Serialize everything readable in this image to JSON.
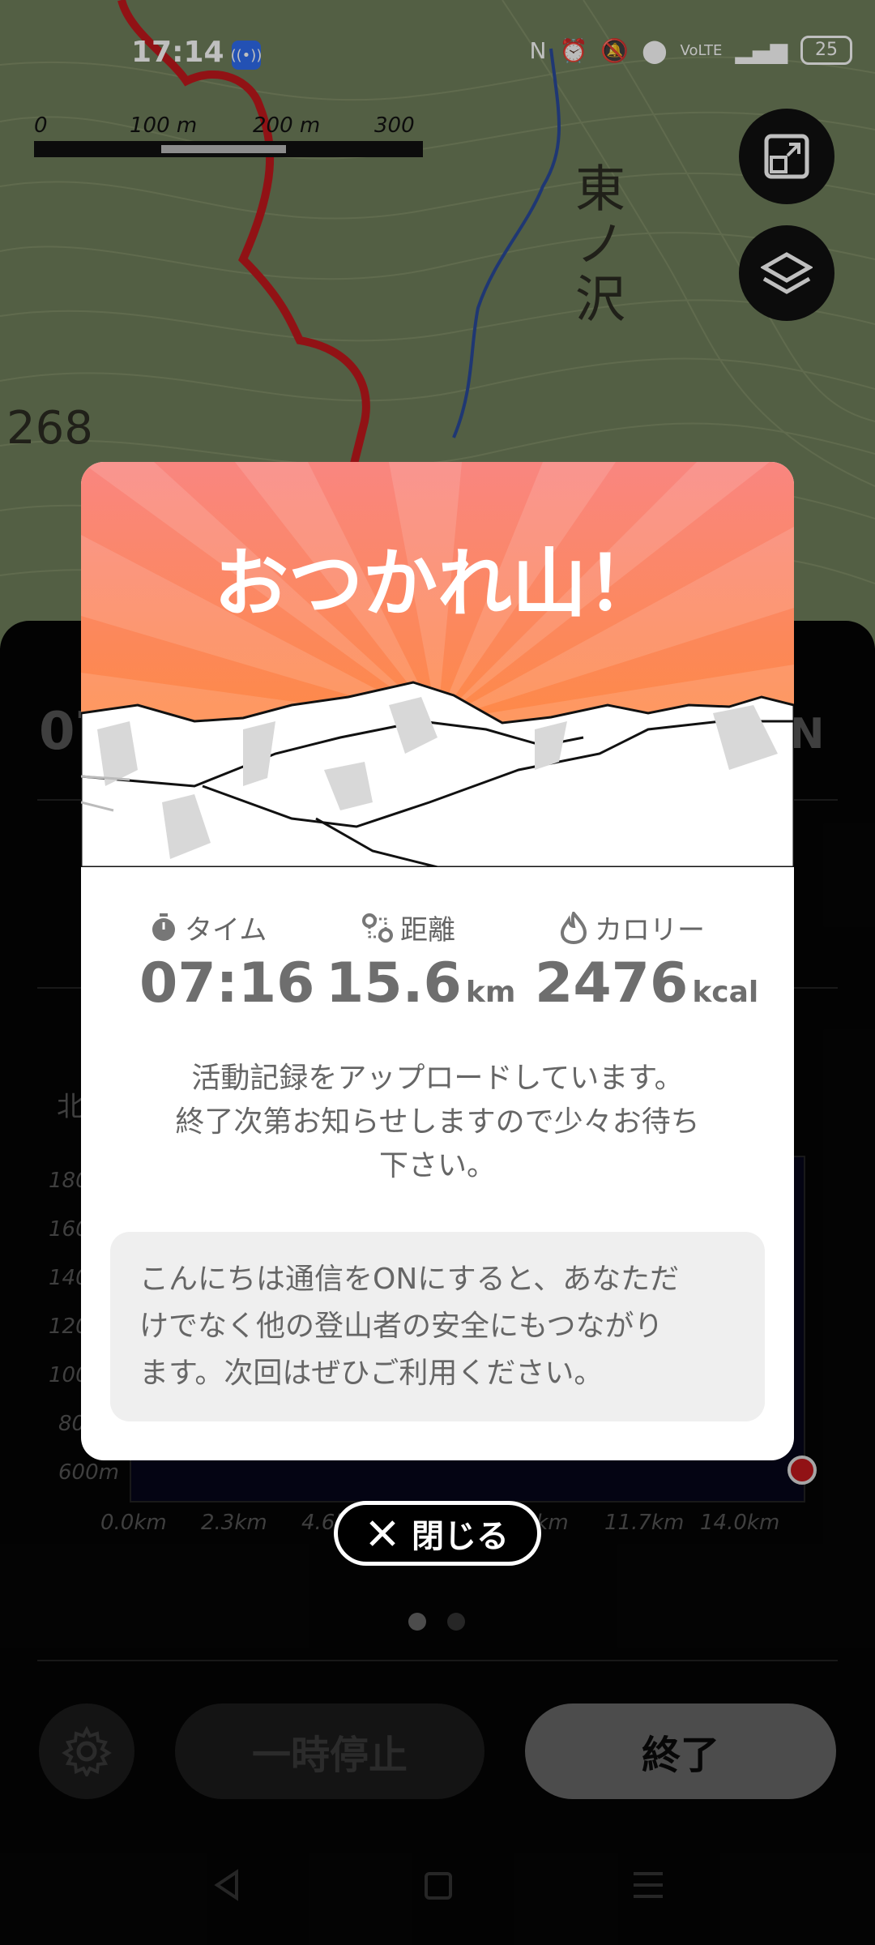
{
  "status_bar": {
    "time": "17:14",
    "battery": "25"
  },
  "map": {
    "scale": {
      "labels": [
        "0",
        "100 m",
        "200 m",
        "300 m"
      ]
    },
    "place_name": "東ノ沢",
    "elevation_label": "268"
  },
  "panel": {
    "partial_time": "07",
    "partial_compass": "N",
    "partial_north_label": "北",
    "chart_y_labels": [
      "180",
      "160",
      "140",
      "120",
      "100",
      "80",
      "600m"
    ],
    "chart_x_labels": [
      "0.0km",
      "2.3km",
      "4.6km",
      "9.3km",
      "11.7km",
      "14.0km"
    ],
    "pause_label": "一時停止",
    "end_label": "終了"
  },
  "dialog": {
    "title": "おつかれ山！",
    "stats": [
      {
        "label": "タイム",
        "value": "07:16",
        "unit": ""
      },
      {
        "label": "距離",
        "value": "15.6",
        "unit": "km"
      },
      {
        "label": "カロリー",
        "value": "2476",
        "unit": "kcal"
      }
    ],
    "upload_message_line1": "活動記録をアップロードしています。",
    "upload_message_line2": "終了次第お知らせしますので少々お待ち",
    "upload_message_line3": "下さい。",
    "notice_line1": "こんにちは通信をONにすると、あなただ",
    "notice_line2": "けでなく他の登山者の安全にもつながり",
    "notice_line3": "ます。次回はぜひご利用ください。"
  },
  "close_button": {
    "label": "閉じる"
  },
  "colors": {
    "accent_orange": "#ff8a3a",
    "title_pink": "#f88278",
    "map_bg": "#7a8866",
    "track_red": "#c2181d"
  },
  "icons": {
    "timer": "stopwatch-icon",
    "distance": "route-pin-icon",
    "calorie": "flame-icon",
    "settings": "gear-icon",
    "close": "close-icon"
  }
}
